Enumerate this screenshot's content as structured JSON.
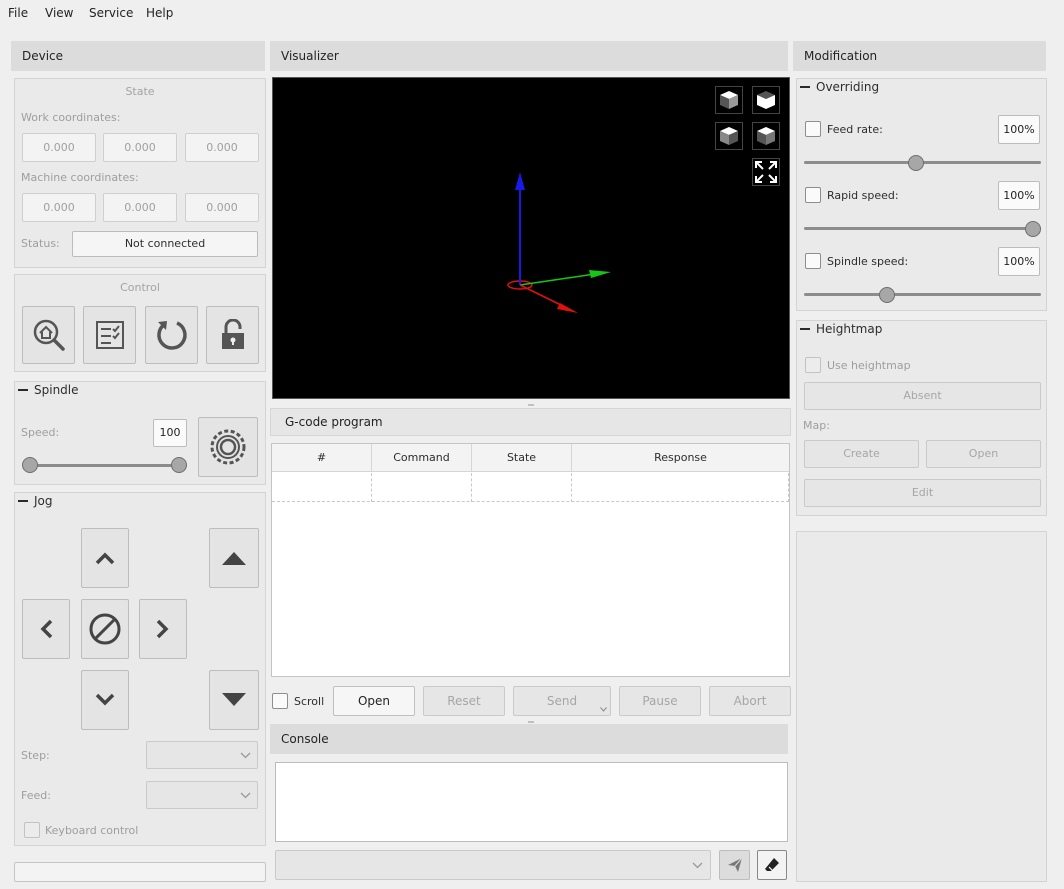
{
  "menu": {
    "file": "File",
    "view": "View",
    "service": "Service",
    "help": "Help"
  },
  "device": {
    "title": "Device",
    "state": {
      "title": "State",
      "work_label": "Work coordinates:",
      "work": [
        "0.000",
        "0.000",
        "0.000"
      ],
      "machine_label": "Machine coordinates:",
      "machine": [
        "0.000",
        "0.000",
        "0.000"
      ],
      "status_label": "Status:",
      "status_value": "Not connected"
    },
    "control": {
      "title": "Control"
    },
    "spindle": {
      "title": "Spindle",
      "speed_label": "Speed:",
      "speed_value": "100"
    },
    "jog": {
      "title": "Jog",
      "step_label": "Step:",
      "feed_label": "Feed:",
      "keyboard_label": "Keyboard control"
    }
  },
  "visualizer": {
    "title": "Visualizer"
  },
  "gcode": {
    "title": "G-code program",
    "columns": [
      "#",
      "Command",
      "State",
      "Response"
    ],
    "scroll_label": "Scroll",
    "buttons": {
      "open": "Open",
      "reset": "Reset",
      "send": "Send",
      "pause": "Pause",
      "abort": "Abort"
    }
  },
  "console": {
    "title": "Console"
  },
  "modification": {
    "title": "Modification",
    "overriding": {
      "title": "Overriding",
      "feed_label": "Feed rate:",
      "feed_value": "100%",
      "feed_level": 0.47,
      "rapid_label": "Rapid speed:",
      "rapid_value": "100%",
      "rapid_level": 1.0,
      "spindle_label": "Spindle speed:",
      "spindle_value": "100%",
      "spindle_level": 0.34
    },
    "heightmap": {
      "title": "Heightmap",
      "use_label": "Use heightmap",
      "absent_label": "Absent",
      "map_label": "Map:",
      "create_label": "Create",
      "open_label": "Open",
      "edit_label": "Edit"
    }
  },
  "colors": {
    "axis_x": "#e01010",
    "axis_y": "#10c010",
    "axis_z": "#1010e0"
  }
}
